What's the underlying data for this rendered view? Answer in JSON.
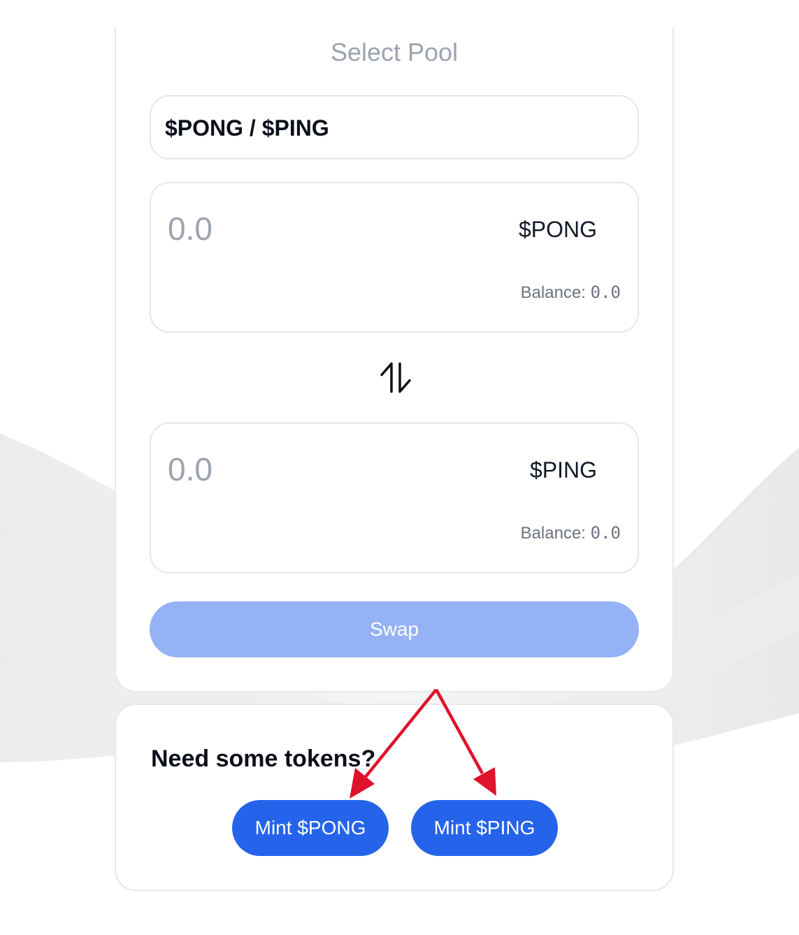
{
  "swap_card": {
    "title": "Select Pool",
    "pool_selected": "$PONG / $PING",
    "from": {
      "amount_placeholder": "0.0",
      "token": "$PONG",
      "balance_label": "Balance:",
      "balance_value": "0.0"
    },
    "to": {
      "amount_placeholder": "0.0",
      "token": "$PING",
      "balance_label": "Balance:",
      "balance_value": "0.0"
    },
    "swap_label": "Swap",
    "swap_icon": "swap-vertical-arrows"
  },
  "mint_card": {
    "heading": "Need some tokens?",
    "mint_pong_label": "Mint $PONG",
    "mint_ping_label": "Mint $PING"
  },
  "colors": {
    "primary": "#2563eb",
    "primary_disabled": "#94b2f5",
    "annotation_arrow": "#e0112b",
    "muted_text": "#9ca3af"
  }
}
